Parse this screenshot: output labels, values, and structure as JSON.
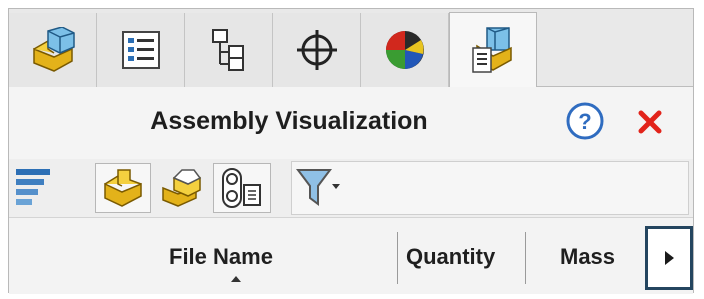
{
  "tabs": [
    {
      "icon": "assembly-part-icon"
    },
    {
      "icon": "property-list-icon"
    },
    {
      "icon": "configuration-tree-icon"
    },
    {
      "icon": "crosshair-icon"
    },
    {
      "icon": "appearance-sphere-icon"
    },
    {
      "icon": "assembly-visualization-icon",
      "active": true
    }
  ],
  "title": "Assembly Visualization",
  "help_icon": "help-icon",
  "close_icon": "close-icon",
  "toolbar": {
    "items": [
      "bar-list-icon",
      "flat-view-icon",
      "nested-view-icon",
      "column-list-icon",
      "filter-icon"
    ]
  },
  "columns": {
    "file_name": "File Name",
    "quantity": "Quantity",
    "mass": "Mass"
  },
  "colors": {
    "close_red": "#e2231a",
    "help_blue": "#2f6cc0",
    "highlight_border": "#24455f"
  }
}
